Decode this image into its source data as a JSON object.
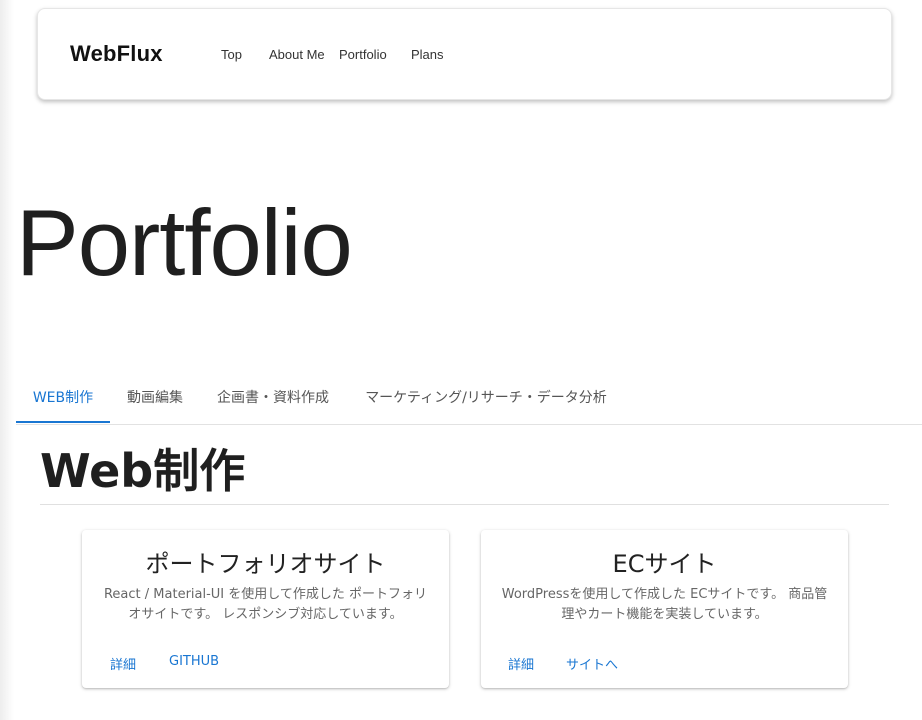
{
  "header": {
    "logo": "WebFlux",
    "nav": [
      {
        "label": "Top"
      },
      {
        "label": "About Me"
      },
      {
        "label": "Portfolio"
      },
      {
        "label": "Plans"
      }
    ]
  },
  "page_title": "Portfolio",
  "tabs": [
    {
      "label": "WEB制作",
      "active": true
    },
    {
      "label": "動画編集",
      "active": false
    },
    {
      "label": "企画書・資料作成",
      "active": false
    },
    {
      "label": "マーケティング/リサーチ・データ分析",
      "active": false
    }
  ],
  "section": {
    "title": "Web制作",
    "cards": [
      {
        "title": "ポートフォリオサイト",
        "description": "React / Material-UI を使用して作成した ポートフォリオサイトです。 レスポンシブ対応しています。",
        "buttons": [
          "詳細",
          "GITHUB"
        ]
      },
      {
        "title": "ECサイト",
        "description": "WordPressを使用して作成した ECサイトです。 商品管理やカート機能を実装しています。",
        "buttons": [
          "詳細",
          "サイトへ"
        ]
      }
    ]
  },
  "colors": {
    "accent": "#1976d2",
    "text": "#1f1f1f"
  }
}
